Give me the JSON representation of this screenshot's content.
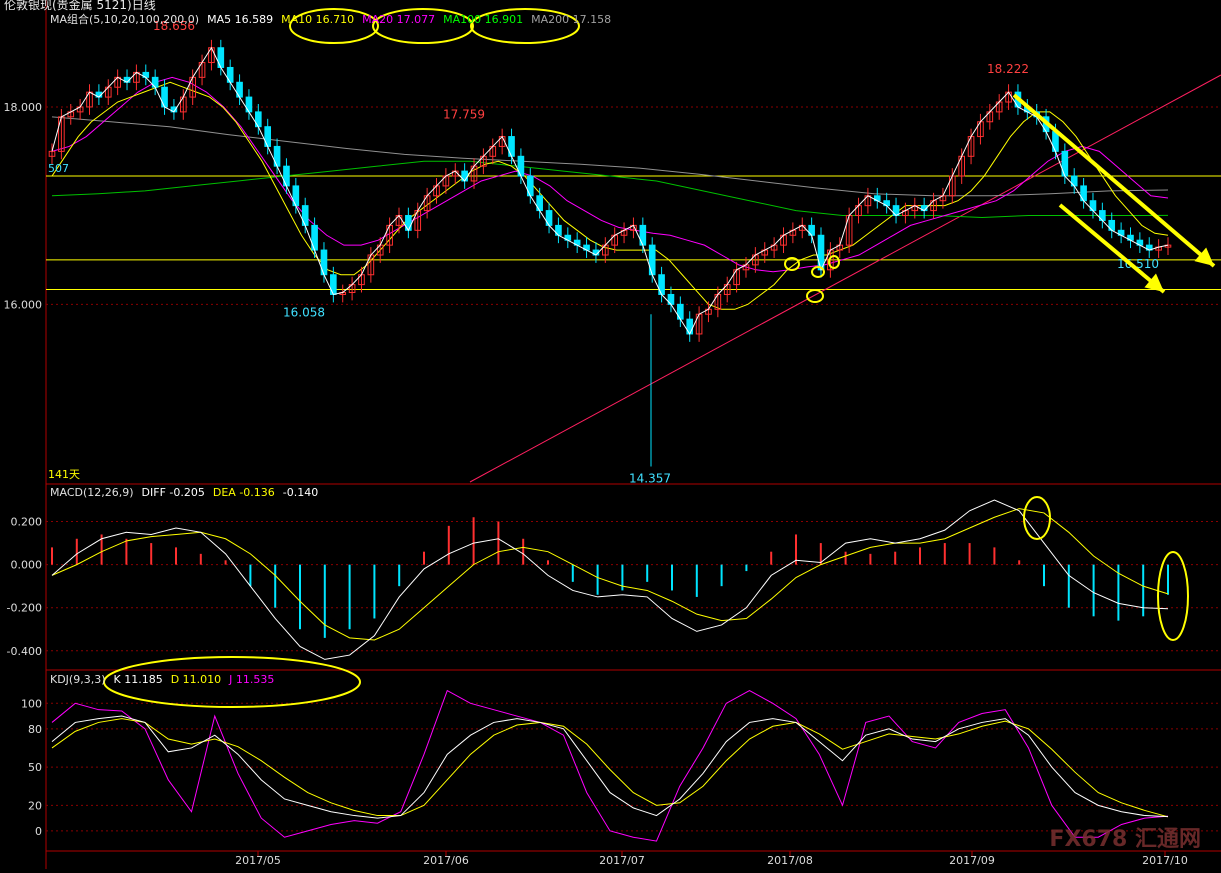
{
  "window": {
    "title": "伦敦银现(贵金属 5121)日线"
  },
  "legends": {
    "price": [
      {
        "text": "MA组合(5,10,20,100,200,0)",
        "color": "#e0e0e0"
      },
      {
        "text": "MA5 16.589",
        "color": "#ffffff"
      },
      {
        "text": "MA10 16.710",
        "color": "#ffff00"
      },
      {
        "text": "MA20 17.077",
        "color": "#ff00ff"
      },
      {
        "text": "MA100 16.901",
        "color": "#00ff00"
      },
      {
        "text": "MA200 17.158",
        "color": "#a0a0a0"
      }
    ],
    "macd": [
      {
        "text": "MACD(12,26,9)",
        "color": "#e0e0e0"
      },
      {
        "text": "DIFF  -0.205",
        "color": "#ffffff"
      },
      {
        "text": "DEA  -0.136",
        "color": "#ffff00"
      },
      {
        "text": "-0.140",
        "color": "#ffffff"
      }
    ],
    "kdj": [
      {
        "text": "KDJ(9,3,3)",
        "color": "#e0e0e0"
      },
      {
        "text": "K  11.185",
        "color": "#ffffff"
      },
      {
        "text": "D  11.010",
        "color": "#ffff00"
      },
      {
        "text": "J  11.535",
        "color": "#ff00ff"
      }
    ]
  },
  "colors": {
    "up": "#ff3030",
    "down": "#00e5ff",
    "grid": "#8a0000",
    "axis": "#b00000",
    "ma5": "#ffffff",
    "ma10": "#ffff00",
    "ma20": "#ff00ff",
    "ma100": "#00c000",
    "ma200": "#909090",
    "highlight": "#ffff00",
    "trend": "#ff2060"
  },
  "chart_data": [
    {
      "type": "candlestick",
      "panel": "price",
      "y_ticks": [
        16.0,
        18.0
      ],
      "y_tick_labels": [
        "16.000",
        "18.000"
      ],
      "ylim": [
        14.2,
        18.8
      ],
      "x_tick_labels": [
        "2017/05",
        "2017/06",
        "2017/07",
        "2017/08",
        "2017/09",
        "2017/10"
      ],
      "annotations": [
        {
          "text": "18.656",
          "value": 18.656,
          "color": "#ff4040"
        },
        {
          "text": "16.058",
          "value": 16.058,
          "color": "#40e0ff"
        },
        {
          "text": "17.759",
          "value": 17.759,
          "color": "#ff4040"
        },
        {
          "text": "14.357",
          "value": 14.357,
          "color": "#40e0ff"
        },
        {
          "text": "18.222",
          "value": 18.222,
          "color": "#ff4040"
        },
        {
          "text": "16.510",
          "value": 16.51,
          "color": "#40e0ff"
        }
      ],
      "edge_labels": {
        "left_level": "507",
        "days": "141天"
      },
      "horizontal_levels": [
        17.3,
        16.45,
        16.15
      ],
      "closes": [
        17.55,
        17.9,
        17.95,
        18.0,
        18.15,
        18.1,
        18.2,
        18.3,
        18.25,
        18.35,
        18.3,
        18.2,
        18.0,
        17.95,
        18.1,
        18.3,
        18.45,
        18.6,
        18.4,
        18.25,
        18.1,
        17.95,
        17.8,
        17.6,
        17.4,
        17.2,
        17.0,
        16.8,
        16.55,
        16.3,
        16.1,
        16.12,
        16.2,
        16.3,
        16.5,
        16.6,
        16.8,
        16.9,
        16.75,
        16.95,
        17.1,
        17.2,
        17.3,
        17.35,
        17.25,
        17.4,
        17.5,
        17.6,
        17.7,
        17.5,
        17.3,
        17.1,
        16.95,
        16.8,
        16.7,
        16.65,
        16.6,
        16.55,
        16.5,
        16.6,
        16.7,
        16.75,
        16.8,
        16.6,
        16.3,
        16.1,
        16.0,
        15.85,
        15.7,
        15.9,
        15.95,
        16.1,
        16.2,
        16.35,
        16.4,
        16.5,
        16.55,
        16.6,
        16.7,
        16.75,
        16.8,
        16.7,
        16.35,
        16.55,
        16.6,
        16.9,
        17.0,
        17.1,
        17.05,
        17.0,
        16.9,
        16.95,
        17.0,
        16.95,
        17.05,
        17.1,
        17.3,
        17.5,
        17.7,
        17.85,
        17.95,
        18.05,
        18.15,
        18.0,
        17.95,
        17.9,
        17.75,
        17.55,
        17.3,
        17.2,
        17.05,
        16.95,
        16.85,
        16.75,
        16.7,
        16.65,
        16.6,
        16.55,
        16.58,
        16.6
      ],
      "ma10_approx": [
        17.3,
        17.5,
        17.7,
        17.85,
        17.95,
        18.05,
        18.1,
        18.15,
        18.2,
        18.25,
        18.2,
        18.15,
        18.1,
        18.0,
        17.85,
        17.65,
        17.45,
        17.2,
        16.95,
        16.7,
        16.5,
        16.35,
        16.3,
        16.3,
        16.4,
        16.55,
        16.7,
        16.85,
        16.95,
        17.05,
        17.15,
        17.25,
        17.35,
        17.42,
        17.45,
        17.4,
        17.3,
        17.15,
        17.0,
        16.85,
        16.75,
        16.65,
        16.58,
        16.55,
        16.55,
        16.55,
        16.55,
        16.45,
        16.3,
        16.15,
        16.0,
        15.95,
        15.95,
        16.0,
        16.1,
        16.2,
        16.35,
        16.45,
        16.5,
        16.5,
        16.55,
        16.6,
        16.7,
        16.8,
        16.9,
        17.0,
        17.0,
        17.0,
        17.0,
        17.05,
        17.15,
        17.3,
        17.5,
        17.7,
        17.85,
        17.95,
        17.95,
        17.85,
        17.7,
        17.5,
        17.3,
        17.1,
        16.95,
        16.8,
        16.72,
        16.7
      ],
      "ma20_approx": [
        17.55,
        17.6,
        17.7,
        17.85,
        18.0,
        18.15,
        18.25,
        18.3,
        18.25,
        18.15,
        18.0,
        17.8,
        17.55,
        17.3,
        17.05,
        16.85,
        16.7,
        16.6,
        16.6,
        16.65,
        16.75,
        16.85,
        16.95,
        17.05,
        17.15,
        17.25,
        17.3,
        17.35,
        17.3,
        17.2,
        17.05,
        16.95,
        16.85,
        16.78,
        16.75,
        16.72,
        16.7,
        16.65,
        16.6,
        16.5,
        16.4,
        16.35,
        16.33,
        16.35,
        16.38,
        16.4,
        16.45,
        16.5,
        16.6,
        16.7,
        16.8,
        16.85,
        16.9,
        16.95,
        17.0,
        17.05,
        17.15,
        17.3,
        17.45,
        17.55,
        17.6,
        17.55,
        17.4,
        17.25,
        17.1,
        17.077
      ],
      "ma100_approx": [
        17.1,
        17.12,
        17.15,
        17.2,
        17.25,
        17.3,
        17.35,
        17.4,
        17.45,
        17.45,
        17.4,
        17.35,
        17.3,
        17.25,
        17.15,
        17.05,
        16.95,
        16.9,
        16.9,
        16.9,
        16.88,
        16.9,
        16.9,
        16.9,
        16.901
      ],
      "ma200_approx": [
        17.9,
        17.85,
        17.8,
        17.72,
        17.65,
        17.58,
        17.52,
        17.48,
        17.45,
        17.42,
        17.38,
        17.32,
        17.25,
        17.18,
        17.12,
        17.1,
        17.1,
        17.12,
        17.15,
        17.158
      ]
    },
    {
      "type": "macd",
      "panel": "macd",
      "y_ticks": [
        0.2,
        0.0,
        -0.2,
        -0.4
      ],
      "y_tick_labels": [
        "0.200",
        "0.000",
        "-0.200",
        "-0.400"
      ],
      "ylim": [
        -0.48,
        0.3
      ],
      "diff": [
        -0.05,
        0.05,
        0.12,
        0.15,
        0.14,
        0.17,
        0.15,
        0.05,
        -0.1,
        -0.25,
        -0.38,
        -0.44,
        -0.42,
        -0.33,
        -0.15,
        -0.02,
        0.05,
        0.1,
        0.12,
        0.05,
        -0.05,
        -0.12,
        -0.15,
        -0.14,
        -0.15,
        -0.25,
        -0.31,
        -0.28,
        -0.2,
        -0.05,
        0.02,
        0.01,
        0.1,
        0.12,
        0.1,
        0.12,
        0.16,
        0.25,
        0.3,
        0.25,
        0.1,
        -0.05,
        -0.13,
        -0.18,
        -0.2,
        -0.205
      ],
      "dea": [
        -0.05,
        0.0,
        0.06,
        0.11,
        0.13,
        0.14,
        0.15,
        0.12,
        0.05,
        -0.05,
        -0.17,
        -0.28,
        -0.34,
        -0.35,
        -0.3,
        -0.2,
        -0.1,
        0.0,
        0.06,
        0.08,
        0.06,
        0.0,
        -0.06,
        -0.1,
        -0.12,
        -0.17,
        -0.23,
        -0.26,
        -0.25,
        -0.16,
        -0.06,
        0.0,
        0.04,
        0.08,
        0.1,
        0.1,
        0.12,
        0.17,
        0.22,
        0.26,
        0.24,
        0.15,
        0.04,
        -0.04,
        -0.1,
        -0.136
      ],
      "hist": [
        0.08,
        0.12,
        0.14,
        0.12,
        0.1,
        0.08,
        0.05,
        0.02,
        -0.1,
        -0.2,
        -0.3,
        -0.34,
        -0.3,
        -0.25,
        -0.1,
        0.06,
        0.18,
        0.22,
        0.2,
        0.12,
        0.02,
        -0.08,
        -0.14,
        -0.12,
        -0.08,
        -0.12,
        -0.15,
        -0.1,
        -0.03,
        0.06,
        0.14,
        0.1,
        0.06,
        0.05,
        0.06,
        0.08,
        0.1,
        0.1,
        0.08,
        0.02,
        -0.1,
        -0.2,
        -0.24,
        -0.26,
        -0.24,
        -0.14
      ]
    },
    {
      "type": "kdj",
      "panel": "kdj",
      "y_ticks": [
        100,
        80,
        50,
        20,
        0
      ],
      "y_tick_labels": [
        "100",
        "80",
        "50",
        "20",
        "0"
      ],
      "ylim": [
        -15,
        112
      ],
      "k": [
        70,
        85,
        88,
        90,
        85,
        62,
        65,
        75,
        60,
        40,
        25,
        20,
        15,
        12,
        10,
        12,
        30,
        60,
        75,
        85,
        88,
        85,
        80,
        55,
        30,
        18,
        12,
        25,
        45,
        70,
        85,
        88,
        85,
        70,
        55,
        75,
        80,
        72,
        70,
        80,
        85,
        88,
        75,
        50,
        30,
        20,
        15,
        12,
        11.185
      ],
      "d": [
        65,
        78,
        85,
        88,
        85,
        72,
        68,
        72,
        66,
        55,
        42,
        30,
        22,
        16,
        12,
        12,
        20,
        40,
        60,
        75,
        83,
        85,
        82,
        68,
        48,
        30,
        20,
        22,
        35,
        55,
        72,
        82,
        85,
        76,
        64,
        70,
        76,
        74,
        72,
        76,
        82,
        86,
        80,
        64,
        46,
        30,
        22,
        16,
        11.01
      ],
      "j": [
        85,
        100,
        95,
        94,
        80,
        40,
        15,
        90,
        45,
        10,
        -5,
        0,
        5,
        8,
        6,
        15,
        60,
        110,
        100,
        95,
        90,
        85,
        75,
        30,
        0,
        -5,
        -8,
        35,
        65,
        100,
        110,
        100,
        88,
        60,
        20,
        85,
        90,
        70,
        65,
        85,
        92,
        95,
        65,
        20,
        -5,
        -5,
        5,
        10,
        11.535
      ]
    }
  ]
}
